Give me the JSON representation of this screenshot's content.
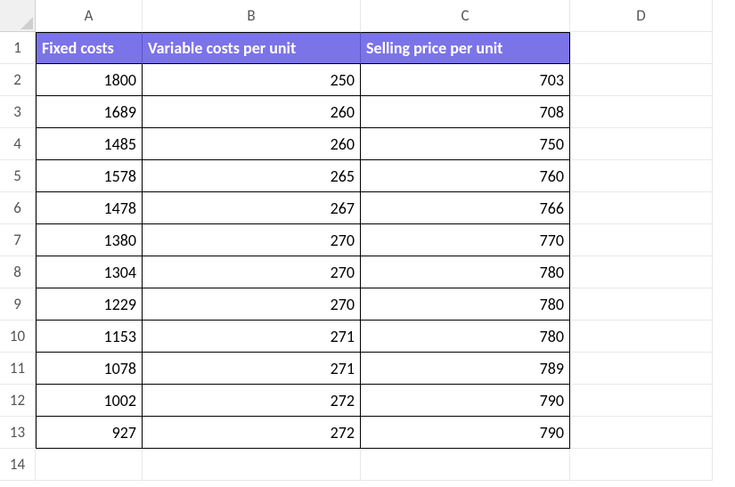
{
  "columns": [
    "A",
    "B",
    "C",
    "D"
  ],
  "rowNumbers": [
    "1",
    "2",
    "3",
    "4",
    "5",
    "6",
    "7",
    "8",
    "9",
    "10",
    "11",
    "12",
    "13",
    "14"
  ],
  "headers": {
    "a": "Fixed costs",
    "b": "Variable costs per unit",
    "c": "Selling price per unit"
  },
  "rows": [
    {
      "a": "1800",
      "b": "250",
      "c": "703"
    },
    {
      "a": "1689",
      "b": "260",
      "c": "708"
    },
    {
      "a": "1485",
      "b": "260",
      "c": "750"
    },
    {
      "a": "1578",
      "b": "265",
      "c": "760"
    },
    {
      "a": "1478",
      "b": "267",
      "c": "766"
    },
    {
      "a": "1380",
      "b": "270",
      "c": "770"
    },
    {
      "a": "1304",
      "b": "270",
      "c": "780"
    },
    {
      "a": "1229",
      "b": "270",
      "c": "780"
    },
    {
      "a": "1153",
      "b": "271",
      "c": "780"
    },
    {
      "a": "1078",
      "b": "271",
      "c": "789"
    },
    {
      "a": "1002",
      "b": "272",
      "c": "790"
    },
    {
      "a": "927",
      "b": "272",
      "c": "790"
    }
  ]
}
